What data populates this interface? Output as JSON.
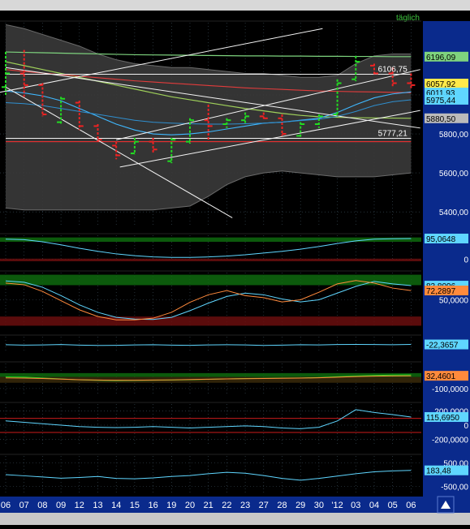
{
  "header": {
    "interval_label": "täglich"
  },
  "colors": {
    "background": "#000000",
    "band_fill": "#3a3a3a",
    "bull_candle": "#22dd22",
    "bear_candle": "#ee2222",
    "overbought_zone": "#0e6a0e",
    "oversold_zone": "#6a0e0e",
    "axis_panel": "#0a2a8c",
    "grid": "#3c4f5c"
  },
  "x_axis": {
    "ticks": [
      "06",
      "07",
      "08",
      "09",
      "12",
      "13",
      "14",
      "15",
      "16",
      "19",
      "20",
      "21",
      "22",
      "23",
      "27",
      "28",
      "29",
      "30",
      "'12",
      "03",
      "04",
      "05",
      "06"
    ]
  },
  "chart_data": [
    {
      "type": "candlestick",
      "panel": "price",
      "ylim": [
        5330,
        6370
      ],
      "y_ticks": [
        {
          "value": 5400,
          "label": "5400,00"
        },
        {
          "value": 5600,
          "label": "5600,00"
        },
        {
          "value": 5800,
          "label": "5800,00"
        },
        {
          "value": 6000,
          "label": "6000,00"
        }
      ],
      "value_tags": [
        {
          "value": 6196,
          "label": "6196,09",
          "color": "#7ed37e"
        },
        {
          "value": 6058,
          "label": "6057,92",
          "color": "#ffe94a"
        },
        {
          "value": 6012,
          "label": "6011,93",
          "color": "#5fd6ff"
        },
        {
          "value": 5975,
          "label": "5975,44",
          "color": "#5fd6ff"
        },
        {
          "value": 5880,
          "label": "5880,50",
          "color": "#bbbbbb"
        }
      ],
      "annotations": [
        {
          "value": 6106,
          "index": 21,
          "label": "6106,75"
        },
        {
          "value": 5777,
          "index": 21,
          "label": "5777,21"
        }
      ],
      "candles": [
        {
          "x": "06",
          "open": 6040,
          "high": 6220,
          "low": 6000,
          "close": 6110
        },
        {
          "x": "07",
          "open": 6110,
          "high": 6230,
          "low": 5990,
          "close": 6050
        },
        {
          "x": "08",
          "open": 6050,
          "high": 6060,
          "low": 5890,
          "close": 5900
        },
        {
          "x": "09",
          "open": 5860,
          "high": 5990,
          "low": 5850,
          "close": 5980
        },
        {
          "x": "12",
          "open": 5960,
          "high": 5970,
          "low": 5820,
          "close": 5840
        },
        {
          "x": "13",
          "open": 5840,
          "high": 5850,
          "low": 5760,
          "close": 5770
        },
        {
          "x": "14",
          "open": 5740,
          "high": 5760,
          "low": 5670,
          "close": 5690
        },
        {
          "x": "15",
          "open": 5700,
          "high": 5780,
          "low": 5695,
          "close": 5760
        },
        {
          "x": "16",
          "open": 5760,
          "high": 5780,
          "low": 5700,
          "close": 5720
        },
        {
          "x": "19",
          "open": 5660,
          "high": 5780,
          "low": 5650,
          "close": 5770
        },
        {
          "x": "20",
          "open": 5760,
          "high": 5880,
          "low": 5750,
          "close": 5870
        },
        {
          "x": "21",
          "open": 5870,
          "high": 5950,
          "low": 5760,
          "close": 5840
        },
        {
          "x": "22",
          "open": 5850,
          "high": 5880,
          "low": 5830,
          "close": 5870
        },
        {
          "x": "23",
          "open": 5870,
          "high": 5910,
          "low": 5850,
          "close": 5890
        },
        {
          "x": "27",
          "open": 5890,
          "high": 5910,
          "low": 5870,
          "close": 5880
        },
        {
          "x": "28",
          "open": 5880,
          "high": 5900,
          "low": 5790,
          "close": 5800
        },
        {
          "x": "29",
          "open": 5790,
          "high": 5860,
          "low": 5780,
          "close": 5850
        },
        {
          "x": "30",
          "open": 5850,
          "high": 5900,
          "low": 5830,
          "close": 5890
        },
        {
          "x": "'12",
          "open": 5900,
          "high": 6080,
          "low": 5890,
          "close": 6060
        },
        {
          "x": "03",
          "open": 6080,
          "high": 6200,
          "low": 6070,
          "close": 6170
        },
        {
          "x": "04",
          "open": 6150,
          "high": 6160,
          "low": 6100,
          "close": 6110
        },
        {
          "x": "05",
          "open": 6110,
          "high": 6140,
          "low": 6040,
          "close": 6060
        },
        {
          "x": "06",
          "open": 6060,
          "high": 6110,
          "low": 6030,
          "close": 6050
        }
      ],
      "band_upper": [
        6360,
        6340,
        6310,
        6280,
        6250,
        6210,
        6180,
        6160,
        6150,
        6140,
        6140,
        6130,
        6120,
        6110,
        6110,
        6100,
        6090,
        6090,
        6100,
        6160,
        6200,
        6210,
        6210
      ],
      "band_lower": [
        5420,
        5410,
        5410,
        5410,
        5410,
        5410,
        5410,
        5410,
        5410,
        5420,
        5430,
        5480,
        5540,
        5580,
        5600,
        5610,
        5600,
        5590,
        5580,
        5580,
        5580,
        5590,
        5600
      ],
      "lines": [
        {
          "name": "",
          "color": "#7ed37e",
          "width": 1.2,
          "values": [
            6220,
            6218,
            6216,
            6214,
            6212,
            6210,
            6208,
            6206,
            6205,
            6204,
            6203,
            6202,
            6201,
            6200,
            6200,
            6199,
            6199,
            6198,
            6198,
            6197,
            6197,
            6196,
            6196
          ]
        },
        {
          "name": "",
          "color": "#9fd05a",
          "width": 1.2,
          "values": [
            6170,
            6150,
            6130,
            6110,
            6090,
            6070,
            6050,
            6030,
            6010,
            5990,
            5975,
            5960,
            5945,
            5930,
            5918,
            5905,
            5895,
            5888,
            5885,
            5883,
            5882,
            5881,
            5880
          ]
        },
        {
          "name": "",
          "color": "#e23c3c",
          "width": 1.1,
          "values": [
            6130,
            6120,
            6112,
            6104,
            6096,
            6088,
            6080,
            6072,
            6066,
            6060,
            6054,
            6048,
            6042,
            6036,
            6032,
            6028,
            6024,
            6020,
            6018,
            6016,
            6015,
            6013,
            6011
          ]
        },
        {
          "name": "",
          "color": "#3fb8ff",
          "width": 1.1,
          "values": [
            6020,
            6010,
            5995,
            5970,
            5930,
            5890,
            5850,
            5820,
            5800,
            5795,
            5800,
            5810,
            5825,
            5840,
            5855,
            5860,
            5870,
            5880,
            5910,
            5950,
            5985,
            6005,
            6015
          ]
        },
        {
          "name": "",
          "color": "#2f8fcf",
          "width": 1.0,
          "values": [
            5960,
            5955,
            5945,
            5930,
            5915,
            5900,
            5885,
            5870,
            5860,
            5855,
            5852,
            5850,
            5850,
            5852,
            5855,
            5860,
            5868,
            5875,
            5890,
            5915,
            5945,
            5965,
            5975
          ]
        },
        {
          "name": "",
          "color": "#f0f0f0",
          "width": 1.0,
          "values": [
            5777,
            5777,
            5777,
            5777,
            5777,
            5777,
            5777,
            5777,
            5777,
            5777,
            5777,
            5777,
            5777,
            5777,
            5777,
            5777,
            5777,
            5777,
            5777,
            5777,
            5777,
            5777,
            5777
          ]
        },
        {
          "name": "",
          "color": "#ff3030",
          "width": 1.0,
          "values": [
            5760,
            5760,
            5760,
            5760,
            5760,
            5760,
            5760,
            5760,
            5760,
            5760,
            5760,
            5760,
            5760,
            5760,
            5760,
            5760,
            5760,
            5760,
            5760,
            5760,
            5760,
            5760,
            5760
          ]
        },
        {
          "name": "",
          "color": "#f0f0f0",
          "width": 1.0,
          "values": [
            6106,
            6106,
            6106,
            6106,
            6106,
            6106,
            6106,
            6106,
            6106,
            6106,
            6106,
            6106,
            6106,
            6106,
            6106,
            6106,
            6106,
            6106,
            6106,
            6106,
            6106,
            6106,
            6106
          ]
        }
      ],
      "trendlines": [
        {
          "x1": -0.5,
          "y1": 6010,
          "x2": 17.2,
          "y2": 6340
        },
        {
          "x1": 0.0,
          "y1": 6040,
          "x2": 12.3,
          "y2": 5370
        },
        {
          "x1": 6.2,
          "y1": 5630,
          "x2": 22.5,
          "y2": 5920
        },
        {
          "x1": 6.0,
          "y1": 5770,
          "x2": 22.5,
          "y2": 6130
        },
        {
          "x1": 0.0,
          "y1": 6140,
          "x2": 22.5,
          "y2": 5830
        }
      ]
    },
    {
      "type": "line",
      "panel": "ind1",
      "ylim": [
        -10,
        110
      ],
      "y_ticks": [
        {
          "value": 0,
          "label": "0"
        }
      ],
      "zones": [
        {
          "from": 80,
          "to": 100,
          "color": "#0e6a0e"
        },
        {
          "from": -10,
          "to": 2,
          "color": "#6a0e0e"
        }
      ],
      "value_tags": [
        {
          "value": 95.06,
          "label": "95,0648",
          "color": "#5fd6ff"
        }
      ],
      "series": [
        {
          "name": "",
          "color": "#5fd6ff",
          "values": [
            92,
            90,
            80,
            66,
            50,
            36,
            24,
            16,
            10,
            8,
            8,
            10,
            14,
            20,
            28,
            36,
            46,
            58,
            72,
            84,
            92,
            94,
            95
          ]
        }
      ]
    },
    {
      "type": "line",
      "panel": "ind2",
      "ylim": [
        -15,
        115
      ],
      "y_ticks": [
        {
          "value": 50,
          "label": "50,0000"
        }
      ],
      "zones": [
        {
          "from": 85,
          "to": 110,
          "color": "#0e6a0e"
        },
        {
          "from": -12,
          "to": 10,
          "color": "#6a0e0e"
        }
      ],
      "value_tags": [
        {
          "value": 83.81,
          "label": "83,8096",
          "color": "#5fd6ff"
        },
        {
          "value": 72.29,
          "label": "72,2897",
          "color": "#ff8a3c"
        }
      ],
      "series": [
        {
          "name": "",
          "color": "#5fd6ff",
          "values": [
            95,
            92,
            80,
            60,
            38,
            20,
            8,
            4,
            3,
            8,
            24,
            42,
            58,
            66,
            62,
            52,
            45,
            50,
            66,
            82,
            94,
            88,
            84
          ]
        },
        {
          "name": "",
          "color": "#ff8a3c",
          "values": [
            90,
            86,
            70,
            48,
            26,
            10,
            2,
            2,
            6,
            20,
            44,
            62,
            72,
            60,
            55,
            45,
            50,
            68,
            88,
            96,
            90,
            78,
            72
          ]
        }
      ]
    },
    {
      "type": "line",
      "panel": "ind3",
      "ylim": [
        -60,
        20
      ],
      "value_tags": [
        {
          "value": -22.37,
          "label": "-22,3657",
          "color": "#5fd6ff"
        }
      ],
      "series": [
        {
          "name": "",
          "color": "#5fd6ff",
          "values": [
            -24,
            -26,
            -25,
            -23,
            -26,
            -28,
            -27,
            -25,
            -24,
            -26,
            -27,
            -25,
            -24,
            -25,
            -28,
            -26,
            -24,
            -25,
            -23,
            -22,
            -23,
            -24,
            -22
          ]
        }
      ]
    },
    {
      "type": "line",
      "panel": "ind4",
      "ylim": [
        -160,
        160
      ],
      "y_ticks": [
        {
          "value": -100,
          "label": "-100,0000"
        }
      ],
      "zones": [
        {
          "from": 20,
          "to": 60,
          "color": "#0e6a0e"
        },
        {
          "from": -40,
          "to": 20,
          "color": "#3a2a0a"
        }
      ],
      "value_tags": [
        {
          "value": 32.46,
          "label": "32,4601",
          "color": "#ff8a3c"
        }
      ],
      "series": [
        {
          "name": "",
          "color": "#22dd22",
          "values": [
            20,
            18,
            10,
            0,
            -10,
            -15,
            -18,
            -16,
            -14,
            -12,
            -8,
            -4,
            0,
            4,
            6,
            8,
            10,
            14,
            22,
            30,
            36,
            40,
            42
          ]
        },
        {
          "name": "",
          "color": "#ff8a3c",
          "values": [
            10,
            8,
            4,
            -2,
            -8,
            -12,
            -14,
            -14,
            -12,
            -10,
            -6,
            -3,
            0,
            2,
            4,
            6,
            8,
            12,
            18,
            24,
            28,
            31,
            32
          ]
        }
      ]
    },
    {
      "type": "line",
      "panel": "ind5",
      "ylim": [
        -300,
        300
      ],
      "y_ticks": [
        {
          "value": 200,
          "label": "200,0000"
        },
        {
          "value": 0,
          "label": "0"
        },
        {
          "value": -200,
          "label": "-200,0000"
        }
      ],
      "zones": [
        {
          "from": 98,
          "to": 102,
          "color": "#ee2222"
        },
        {
          "from": -102,
          "to": -98,
          "color": "#ee2222"
        }
      ],
      "value_tags": [
        {
          "value": 115.7,
          "label": "115,6950",
          "color": "#5fd6ff"
        }
      ],
      "series": [
        {
          "name": "",
          "color": "#5fd6ff",
          "values": [
            60,
            40,
            20,
            0,
            -20,
            -30,
            -35,
            -30,
            -20,
            -30,
            -40,
            -30,
            -20,
            -10,
            -20,
            -40,
            -50,
            -30,
            60,
            220,
            180,
            150,
            116
          ]
        }
      ]
    },
    {
      "type": "line",
      "panel": "ind6",
      "ylim": [
        -800,
        800
      ],
      "y_ticks": [
        {
          "value": 500,
          "label": "500,00"
        },
        {
          "value": -500,
          "label": "-500,00"
        }
      ],
      "value_tags": [
        {
          "value": 183.48,
          "label": "183,48",
          "color": "#5fd6ff"
        }
      ],
      "series": [
        {
          "name": "",
          "color": "#5fd6ff",
          "values": [
            0,
            -50,
            -100,
            -150,
            -120,
            -80,
            -160,
            -180,
            -140,
            -80,
            -40,
            40,
            100,
            60,
            -40,
            -160,
            -240,
            -160,
            -60,
            40,
            120,
            160,
            183
          ]
        }
      ]
    }
  ]
}
